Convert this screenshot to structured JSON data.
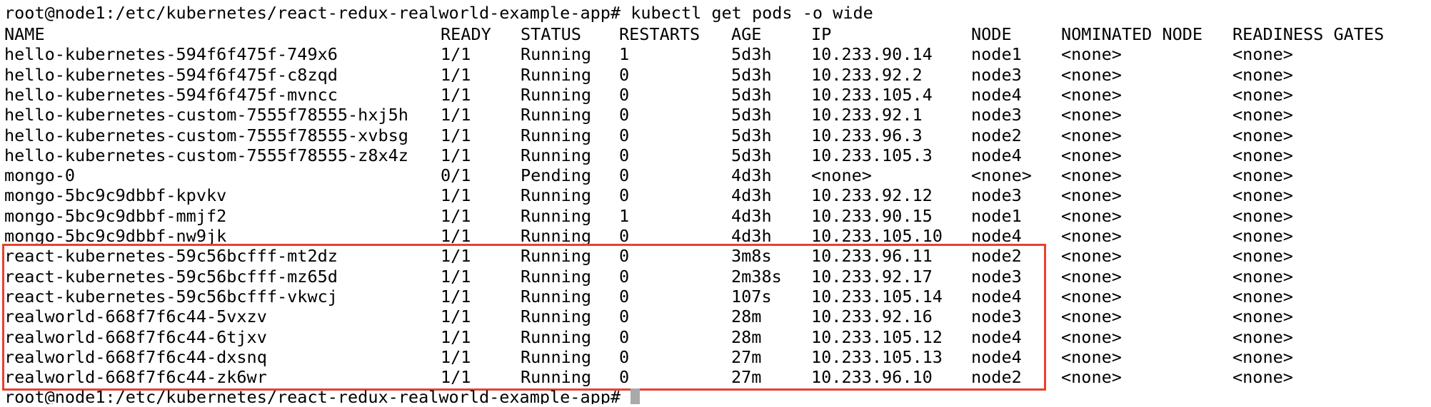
{
  "prompt": "root@node1:/etc/kubernetes/react-redux-realworld-example-app#",
  "command": "kubectl get pods -o wide",
  "headers": [
    "NAME",
    "READY",
    "STATUS",
    "RESTARTS",
    "AGE",
    "IP",
    "NODE",
    "NOMINATED NODE",
    "READINESS GATES"
  ],
  "rows": [
    [
      "hello-kubernetes-594f6f475f-749x6",
      "1/1",
      "Running",
      "1",
      "5d3h",
      "10.233.90.14",
      "node1",
      "<none>",
      "<none>"
    ],
    [
      "hello-kubernetes-594f6f475f-c8zqd",
      "1/1",
      "Running",
      "0",
      "5d3h",
      "10.233.92.2",
      "node3",
      "<none>",
      "<none>"
    ],
    [
      "hello-kubernetes-594f6f475f-mvncc",
      "1/1",
      "Running",
      "0",
      "5d3h",
      "10.233.105.4",
      "node4",
      "<none>",
      "<none>"
    ],
    [
      "hello-kubernetes-custom-7555f78555-hxj5h",
      "1/1",
      "Running",
      "0",
      "5d3h",
      "10.233.92.1",
      "node3",
      "<none>",
      "<none>"
    ],
    [
      "hello-kubernetes-custom-7555f78555-xvbsg",
      "1/1",
      "Running",
      "0",
      "5d3h",
      "10.233.96.3",
      "node2",
      "<none>",
      "<none>"
    ],
    [
      "hello-kubernetes-custom-7555f78555-z8x4z",
      "1/1",
      "Running",
      "0",
      "5d3h",
      "10.233.105.3",
      "node4",
      "<none>",
      "<none>"
    ],
    [
      "mongo-0",
      "0/1",
      "Pending",
      "0",
      "4d3h",
      "<none>",
      "<none>",
      "<none>",
      "<none>"
    ],
    [
      "mongo-5bc9c9dbbf-kpvkv",
      "1/1",
      "Running",
      "0",
      "4d3h",
      "10.233.92.12",
      "node3",
      "<none>",
      "<none>"
    ],
    [
      "mongo-5bc9c9dbbf-mmjf2",
      "1/1",
      "Running",
      "1",
      "4d3h",
      "10.233.90.15",
      "node1",
      "<none>",
      "<none>"
    ],
    [
      "mongo-5bc9c9dbbf-nw9jk",
      "1/1",
      "Running",
      "0",
      "4d3h",
      "10.233.105.10",
      "node4",
      "<none>",
      "<none>"
    ],
    [
      "react-kubernetes-59c56bcfff-mt2dz",
      "1/1",
      "Running",
      "0",
      "3m8s",
      "10.233.96.11",
      "node2",
      "<none>",
      "<none>"
    ],
    [
      "react-kubernetes-59c56bcfff-mz65d",
      "1/1",
      "Running",
      "0",
      "2m38s",
      "10.233.92.17",
      "node3",
      "<none>",
      "<none>"
    ],
    [
      "react-kubernetes-59c56bcfff-vkwcj",
      "1/1",
      "Running",
      "0",
      "107s",
      "10.233.105.14",
      "node4",
      "<none>",
      "<none>"
    ],
    [
      "realworld-668f7f6c44-5vxzv",
      "1/1",
      "Running",
      "0",
      "28m",
      "10.233.92.16",
      "node3",
      "<none>",
      "<none>"
    ],
    [
      "realworld-668f7f6c44-6tjxv",
      "1/1",
      "Running",
      "0",
      "28m",
      "10.233.105.12",
      "node4",
      "<none>",
      "<none>"
    ],
    [
      "realworld-668f7f6c44-dxsnq",
      "1/1",
      "Running",
      "0",
      "27m",
      "10.233.105.13",
      "node4",
      "<none>",
      "<none>"
    ],
    [
      "realworld-668f7f6c44-zk6wr",
      "1/1",
      "Running",
      "0",
      "27m",
      "10.233.96.10",
      "node2",
      "<none>",
      "<none>"
    ]
  ],
  "colors": {
    "background": "#ffffff",
    "text": "#000000",
    "highlight_border": "#e8412e",
    "cursor": "#a9a9a9"
  }
}
